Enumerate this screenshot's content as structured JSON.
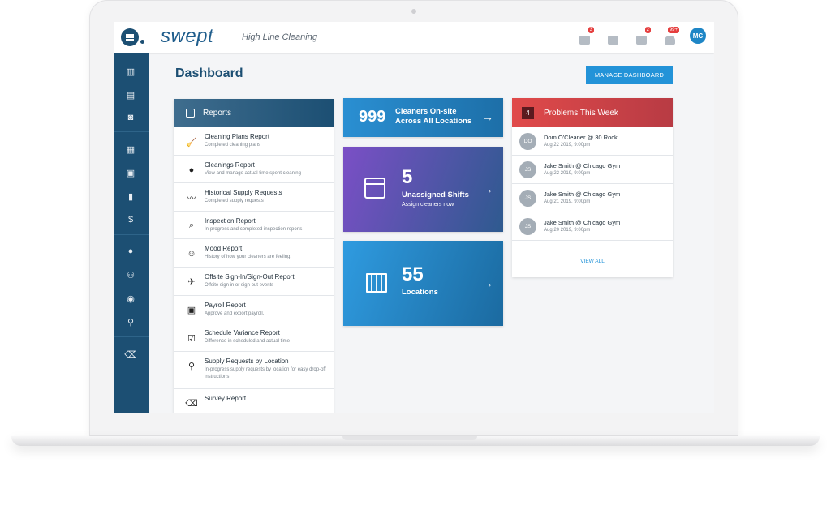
{
  "app": {
    "logo": "swept",
    "org_name": "High Line Cleaning"
  },
  "topbar": {
    "icons": [
      {
        "name": "cart-icon",
        "badge": "3"
      },
      {
        "name": "chat-icon",
        "badge": ""
      },
      {
        "name": "message-icon",
        "badge": "2"
      },
      {
        "name": "bell-icon",
        "badge": "99+"
      }
    ],
    "avatar_initials": "MC"
  },
  "sidebar": {
    "icons": [
      "building-icon",
      "clipboard-icon",
      "search-doc-icon",
      "bar-chart-icon",
      "calendar-icon",
      "spray-bottle-icon",
      "dollar-icon",
      "person-icon",
      "people-icon",
      "person-badge-icon",
      "location-pin-icon",
      "eraser-icon"
    ]
  },
  "page": {
    "title": "Dashboard",
    "manage_button": "MANAGE DASHBOARD"
  },
  "reports": {
    "title": "Reports",
    "items": [
      {
        "title": "Cleaning Plans Report",
        "subtitle": "Completed cleaning plans",
        "icon": "broom-icon",
        "glyph": "🧹"
      },
      {
        "title": "Cleanings Report",
        "subtitle": "View and manage actual time spent cleaning",
        "icon": "bubbles-icon",
        "glyph": "●"
      },
      {
        "title": "Historical Supply Requests",
        "subtitle": "Completed supply requests",
        "icon": "trend-line-icon",
        "glyph": "〰"
      },
      {
        "title": "Inspection Report",
        "subtitle": "In-progress and completed inspection reports",
        "icon": "magnifier-icon",
        "glyph": "⌕"
      },
      {
        "title": "Mood Report",
        "subtitle": "History of how your cleaners are feeling.",
        "icon": "smiley-icon",
        "glyph": "☺"
      },
      {
        "title": "Offsite Sign-In/Sign-Out Report",
        "subtitle": "Offsite sign in or sign out events",
        "icon": "location-off-icon",
        "glyph": "✈"
      },
      {
        "title": "Payroll Report",
        "subtitle": "Approve and export payroll.",
        "icon": "wallet-icon",
        "glyph": "▣"
      },
      {
        "title": "Schedule Variance Report",
        "subtitle": "Difference in scheduled and actual time",
        "icon": "calendar-check-icon",
        "glyph": "☑"
      },
      {
        "title": "Supply Requests by Location",
        "subtitle": "In-progress supply requests by location for easy drop-off instructions",
        "icon": "location-pin-icon",
        "glyph": "⚲"
      },
      {
        "title": "Survey Report",
        "subtitle": "",
        "icon": "eraser-icon",
        "glyph": "⌫"
      }
    ]
  },
  "stats": {
    "cleaners": {
      "value": "999",
      "label": "Cleaners On-site Across All Locations",
      "label_line1": "Cleaners On-site",
      "label_line2": "Across All Locations"
    },
    "shifts": {
      "value": "5",
      "label": "Unassigned Shifts",
      "sub": "Assign cleaners now"
    },
    "locations": {
      "value": "55",
      "label": "Locations"
    }
  },
  "problems": {
    "count": "4",
    "title": "Problems This Week",
    "items": [
      {
        "initials": "DO",
        "name": "Dom O'Cleaner @ 30 Rock",
        "date": "Aug 22 2019, 9:00pm"
      },
      {
        "initials": "JS",
        "name": "Jake Smith @ Chicago Gym",
        "date": "Aug 22 2019, 9:00pm"
      },
      {
        "initials": "JS",
        "name": "Jake Smith @ Chicago Gym",
        "date": "Aug 21 2019, 9:00pm"
      },
      {
        "initials": "JS",
        "name": "Jake Smith @ Chicago Gym",
        "date": "Aug 20 2019, 9:00pm"
      }
    ],
    "view_all": "VIEW ALL"
  }
}
